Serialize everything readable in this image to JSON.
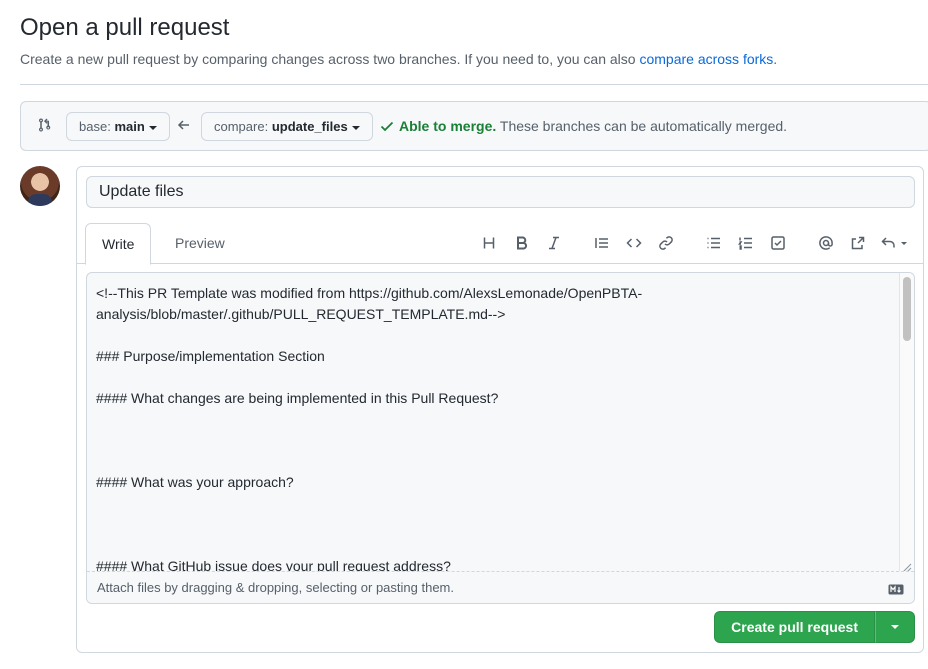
{
  "header": {
    "title": "Open a pull request",
    "subtitle": "Create a new pull request by comparing changes across two branches. If you need to, you can also ",
    "subtitle_link": "compare across forks",
    "subtitle_end": "."
  },
  "range": {
    "base_label": "base:",
    "base_value": "main",
    "compare_label": "compare:",
    "compare_value": "update_files",
    "merge_ok": "Able to merge.",
    "merge_text": " These branches can be automatically merged."
  },
  "composer": {
    "title_value": "Update files",
    "tabs": [
      "Write",
      "Preview"
    ],
    "toolbar": [
      "heading-icon",
      "bold-icon",
      "italic-icon",
      "quote-icon",
      "code-icon",
      "link-icon",
      "unordered-list-icon",
      "ordered-list-icon",
      "task-list-icon",
      "mention-icon",
      "cross-reference-icon",
      "reply-icon"
    ],
    "body": "<!--This PR Template was modified from https://github.com/AlexsLemonade/OpenPBTA-analysis/blob/master/.github/PULL_REQUEST_TEMPLATE.md-->\n\n### Purpose/implementation Section\n\n#### What changes are being implemented in this Pull Request?\n\n\n\n#### What was your approach?\n\n\n\n#### What GitHub issue does your pull request address?",
    "attach_text": "Attach files by dragging & dropping, selecting or pasting them.",
    "submit_label": "Create pull request"
  },
  "colors": {
    "accent": "#0969da",
    "success": "#1a7f37",
    "button_green": "#2da44e"
  }
}
